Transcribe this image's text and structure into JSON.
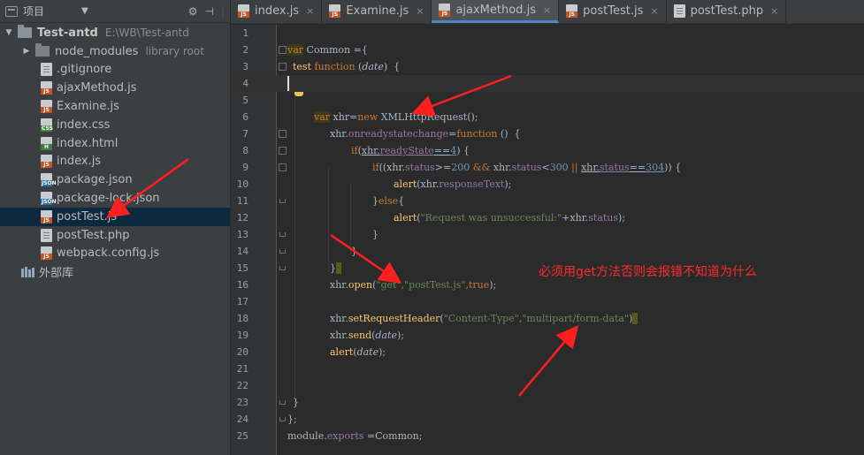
{
  "panel": {
    "title": "项目",
    "dropdown": "▼",
    "tools": [
      "⚙",
      "⊣",
      "|"
    ]
  },
  "tree": [
    {
      "label": "Test-antd",
      "hint": "E:\\WB\\Test-antd",
      "type": "root"
    },
    {
      "label": "node_modules",
      "hint": "library root",
      "type": "folder"
    },
    {
      "label": ".gitignore",
      "type": "plain"
    },
    {
      "label": "ajaxMethod.js",
      "type": "js",
      "badge": "JS"
    },
    {
      "label": "Examine.js",
      "type": "js",
      "badge": "JS"
    },
    {
      "label": "index.css",
      "type": "css",
      "badge": "CSS"
    },
    {
      "label": "index.html",
      "type": "html",
      "badge": "H"
    },
    {
      "label": "index.js",
      "type": "js",
      "badge": "JS"
    },
    {
      "label": "package.json",
      "type": "json",
      "badge": "JSON"
    },
    {
      "label": "package-lock.json",
      "type": "json",
      "badge": "JSON"
    },
    {
      "label": "postTest.js",
      "type": "js",
      "badge": "JS",
      "selected": true
    },
    {
      "label": "postTest.php",
      "type": "plain"
    },
    {
      "label": "webpack.config.js",
      "type": "js",
      "badge": "JS"
    },
    {
      "label": "外部库",
      "type": "lib"
    }
  ],
  "tabs": [
    {
      "label": "index.js",
      "badge": "JS",
      "close": "×"
    },
    {
      "label": "Examine.js",
      "badge": "JS",
      "close": "×"
    },
    {
      "label": "ajaxMethod.js",
      "badge": "JS",
      "close": "×",
      "active": true
    },
    {
      "label": "postTest.js",
      "badge": "JS",
      "close": "×"
    },
    {
      "label": "postTest.php",
      "badge": "",
      "close": "×"
    }
  ],
  "line_numbers": [
    "1",
    "2",
    "3",
    "4",
    "5",
    "6",
    "7",
    "8",
    "9",
    "10",
    "11",
    "12",
    "13",
    "14",
    "15",
    "16",
    "17",
    "18",
    "19",
    "20",
    "21",
    "22",
    "23",
    "24",
    "25"
  ],
  "code": {
    "l2": [
      "var",
      " Common =",
      "{"
    ],
    "l3": [
      "test",
      " ",
      "function",
      " (",
      "date",
      ")  {"
    ],
    "l6": [
      "var",
      " xhr=",
      "new",
      " XMLHttpRequest",
      "();"
    ],
    "l7": [
      "xhr.",
      "onreadystatechange",
      "=",
      "function",
      " ()  {"
    ],
    "l8": [
      "if",
      "(",
      "xhr.",
      "readyState",
      "==",
      "4",
      ") {"
    ],
    "l9": [
      "if",
      "((xhr.",
      "status",
      ">=",
      "200",
      " && ",
      "xhr.",
      "status",
      "<",
      "300",
      " || ",
      "xhr.",
      "status",
      "==",
      "304",
      ")) {"
    ],
    "l10": [
      "alert",
      "(xhr.",
      "responseText",
      ");"
    ],
    "l11": [
      "}",
      "else",
      "{"
    ],
    "l12": [
      "alert",
      "(",
      "\"Request was unsuccessful:\"",
      "+xhr.",
      "status",
      ");"
    ],
    "l13": [
      "}"
    ],
    "l14": [
      "}"
    ],
    "l15": [
      "}",
      "_"
    ],
    "l16": [
      "xhr.",
      "open",
      "(",
      "\"get\"",
      ",",
      "\"postTest.js\"",
      ",",
      "true",
      ");"
    ],
    "l18": [
      "xhr.",
      "setRequestHeader",
      "(",
      "\"Content-Type\"",
      ",",
      "\"multipart/form-data\"",
      ")",
      "_"
    ],
    "l19": [
      "xhr.",
      "send",
      "(",
      "date",
      ");"
    ],
    "l20": [
      "alert",
      "(",
      "date",
      ");"
    ],
    "l23": [
      "}"
    ],
    "l24": [
      "};"
    ],
    "l25": [
      "module.",
      "exports",
      " =",
      "Common",
      ";"
    ]
  },
  "annotation": "必须用get方法否则会报错不知道为什么",
  "colors": {
    "keyword": "#cc7832",
    "string": "#6a8759",
    "number": "#6897bb",
    "property": "#9876aa",
    "method": "#ffc66d",
    "annotation": "#ff2b2b",
    "selection": "#0d293e"
  }
}
